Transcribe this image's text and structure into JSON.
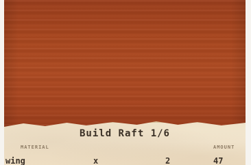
{
  "recipe": {
    "title": "Build Raft 1/6",
    "headers": {
      "material": "MATERIAL",
      "amount": "AMOUNT"
    },
    "rows": [
      {
        "name": "wing",
        "operator": "x",
        "quantity": "2",
        "amount": "47"
      }
    ]
  },
  "colors": {
    "wood": "#a8451f",
    "paper": "#f1e4cc",
    "text": "#3a3026"
  }
}
